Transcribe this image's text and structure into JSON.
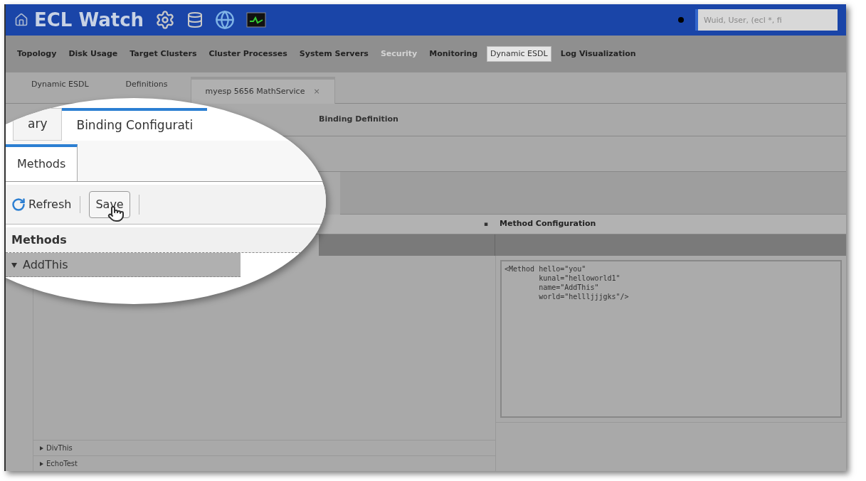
{
  "app": {
    "title": "ECL Watch",
    "search": {
      "placeholder": "Wuid, User, (ecl *, fi"
    }
  },
  "nav": [
    {
      "label": "Topology",
      "selected": false,
      "disabled": false
    },
    {
      "label": "Disk Usage",
      "selected": false,
      "disabled": false
    },
    {
      "label": "Target Clusters",
      "selected": false,
      "disabled": false
    },
    {
      "label": "Cluster Processes",
      "selected": false,
      "disabled": false
    },
    {
      "label": "System Servers",
      "selected": false,
      "disabled": false
    },
    {
      "label": "Security",
      "selected": false,
      "disabled": true
    },
    {
      "label": "Monitoring",
      "selected": false,
      "disabled": false
    },
    {
      "label": "Dynamic ESDL",
      "selected": true,
      "disabled": false
    },
    {
      "label": "Log Visualization",
      "selected": false,
      "disabled": false
    }
  ],
  "tabs": [
    {
      "label": "Dynamic ESDL",
      "selected": false,
      "closable": false
    },
    {
      "label": "Definitions",
      "selected": false,
      "closable": false
    },
    {
      "label": "myesp 5656 MathService",
      "selected": true,
      "closable": true,
      "close": "×"
    }
  ],
  "subtabs": [
    {
      "label": "Binding Definition",
      "selected": false
    }
  ],
  "grid": {
    "column_header": "Method Configuration",
    "sort_mark": "▪",
    "config_lines": [
      "<Method hello=\"you\"",
      "        kunal=\"helloworld1\"",
      "        name=\"AddThis\"",
      "        world=\"hellljjjgks\"/>"
    ],
    "rows": [
      {
        "name": "DivThis",
        "expanded": false
      },
      {
        "name": "EchoTest",
        "expanded": false
      }
    ]
  },
  "magnifier": {
    "tabs": [
      {
        "label": "ary",
        "selected": false
      },
      {
        "label": "Binding Configurati",
        "selected": true
      }
    ],
    "inner_tabs": [
      {
        "label": "Methods",
        "selected": true
      }
    ],
    "toolbar": [
      {
        "label": "Refresh",
        "kind": "refresh"
      },
      {
        "label": "Save",
        "kind": "button"
      }
    ],
    "column_header": "Methods",
    "rows": [
      {
        "name": "AddThis",
        "expanded": true
      }
    ]
  }
}
